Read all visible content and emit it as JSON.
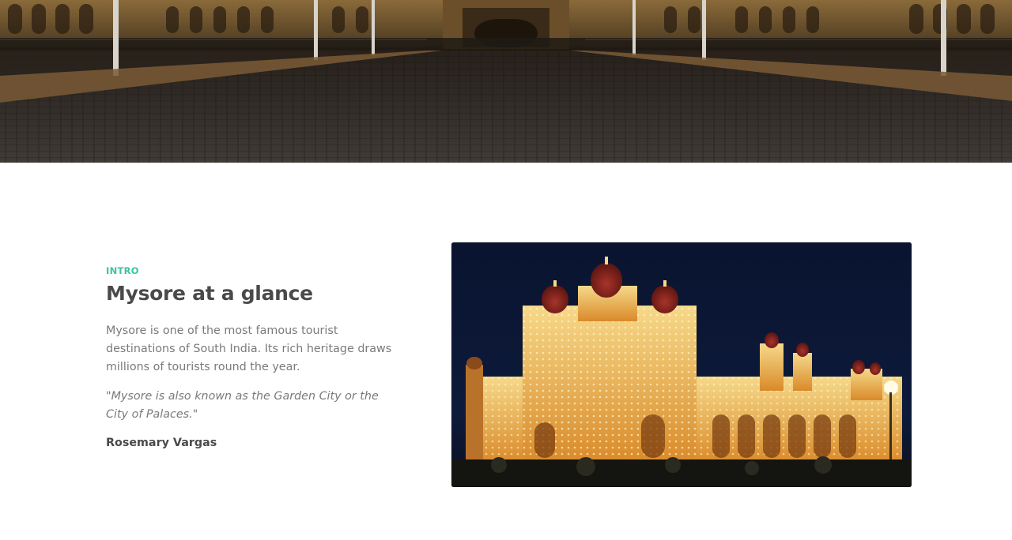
{
  "hero": {
    "image": "palace-courtyard-cobblestone-photo"
  },
  "intro": {
    "eyebrow": "INTRO",
    "title": "Mysore at a glance",
    "body": "Mysore is one of the most famous tourist destinations of South India. Its rich heritage draws millions of tourists round the year.",
    "quote": "\"Mysore is also known as the Garden City or the City of Palaces.\"",
    "author": "Rosemary Vargas",
    "image": "mysore-palace-illuminated-night-photo"
  },
  "colors": {
    "accent": "#3cc3a0",
    "heading": "#4a4a4a",
    "body": "#7a7a7a"
  }
}
